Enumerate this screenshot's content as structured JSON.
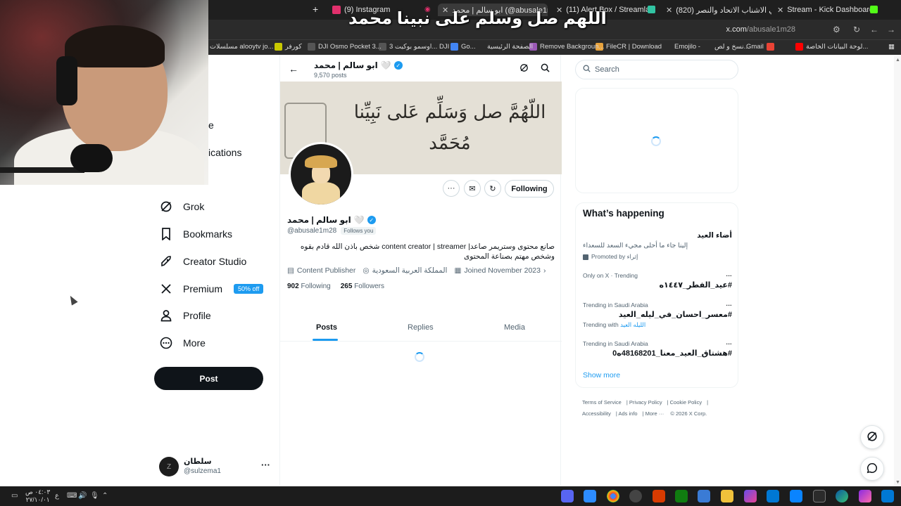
{
  "browser": {
    "tabs": [
      {
        "title": "(9) Instagram",
        "fav_color": "#e1306c"
      },
      {
        "title": "ابو سالم | محمد (@abusale1m28)",
        "fav_color": "#000000",
        "active": true
      },
      {
        "title": "(11) Alert Box / Streamlabs",
        "fav_color": "#31c3a2"
      },
      {
        "title": "(820) تحدي الاشناب الاتحاد والنصر",
        "fav_color": "#ff0000"
      },
      {
        "title": "Stream - Kick Dashboard",
        "fav_color": "#53fc18"
      }
    ],
    "new_tab": "+",
    "url_domain": "x.com",
    "url_path": "/abusale1m28",
    "bookmarks": [
      {
        "label": "لوحة البيانات الخاصة...",
        "color": "#ff0000"
      },
      {
        "label": "Gmail",
        "color": "#ea4335"
      },
      {
        "label": "نسخ و لص...",
        "color": "#f4b400"
      },
      {
        "label": "Emojilo -",
        "color": "#ffcc00"
      },
      {
        "label": "FileCR | Download",
        "color": "#e8a33d"
      },
      {
        "label": "Remove Backgroun...",
        "color": "#9b59b6"
      },
      {
        "label": "الصفحة الرئيسية",
        "color": "#4285f4"
      },
      {
        "label": "Go...",
        "color": "#34a853"
      },
      {
        "label": "اوسمو بوكيت 3... DJI",
        "color": "#666666"
      },
      {
        "label": "DJI Osmo Pocket 3...",
        "color": "#666666"
      },
      {
        "label": "كورفر",
        "color": "#dddd00"
      },
      {
        "label": "مسلسلات alooytv jo...",
        "color": "#ffffff"
      }
    ]
  },
  "overlay_text": "اللهم صل وسلم على نبينا محمد",
  "sidebar": {
    "partial_items": [
      "e",
      "ications"
    ],
    "items": [
      {
        "label": "Grok",
        "icon": "grok-icon"
      },
      {
        "label": "Bookmarks",
        "icon": "bookmark-icon"
      },
      {
        "label": "Creator Studio",
        "icon": "rocket-icon"
      },
      {
        "label": "Premium",
        "icon": "x-logo-icon",
        "badge": "50% off"
      },
      {
        "label": "Profile",
        "icon": "person-icon"
      },
      {
        "label": "More",
        "icon": "more-circle-icon"
      }
    ],
    "post_button": "Post",
    "account": {
      "name": "سلطان",
      "handle": "@sulzema1"
    }
  },
  "profile": {
    "header_name": "ابو سالم | محمد",
    "header_heart": "🤍",
    "post_count": "9,570 posts",
    "banner_text": "اللّهُمَّ صل وَسَلِّم عَلى نَبِيِّنا مُحَمَّد",
    "display_name": "ابو سالم | محمد",
    "handle": "@abusale1m28",
    "follows_you": "Follows you",
    "bio": "صانع محتوى وستريمر صاعد| content creator | streamer  شخص باذن الله قادم بقوه وشخص مهتم بصناعة المحتوى",
    "category": "Content Publisher",
    "location": "المملكة العربية السعودية",
    "joined": "Joined November 2023",
    "following_count": "902",
    "following_label": "Following",
    "followers_count": "265",
    "followers_label": "Followers",
    "follow_button": "Following",
    "tabs": [
      "Posts",
      "Replies",
      "Media"
    ]
  },
  "right": {
    "search_placeholder": "Search",
    "trends_title": "What’s happening",
    "promo": {
      "title": "أضاء العيد",
      "text": "إلينا جاء ما أحلى مجيء السعد للسعداء",
      "by": "Promoted by إثراء"
    },
    "trends": [
      {
        "context": "Only on X · Trending",
        "title": "#عيد_الفطر_١٤٤٧ه"
      },
      {
        "context": "Trending in Saudi Arabia",
        "title": "#معسر_احسان_في_ليله_العيد",
        "with_label": "Trending with",
        "with_link": "الليله العيد"
      },
      {
        "context": "Trending in Saudi Arabia",
        "title": "#هشتاق_العيد_معنا_48168201ه0"
      }
    ],
    "show_more": "Show more",
    "footer": [
      "Terms of Service",
      "Privacy Policy",
      "Cookie Policy",
      "Accessibility",
      "Ads info",
      "More ···",
      "© 2026 X Corp."
    ]
  },
  "taskbar": {
    "time": "٠٤:٠٣ ص",
    "date": "٢٧/١٠/٠١",
    "lang": "ع"
  }
}
